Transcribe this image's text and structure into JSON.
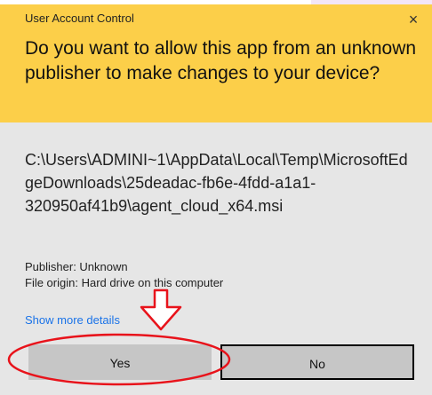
{
  "dialog": {
    "window_title": "User Account Control",
    "close_glyph": "×",
    "question": "Do you want to allow this app from an unknown publisher to make changes to your device?",
    "file_path": "C:\\Users\\ADMINI~1\\AppData\\Local\\Temp\\MicrosoftEdgeDownloads\\25deadac-fb6e-4fdd-a1a1-320950af41b9\\agent_cloud_x64.msi",
    "publisher": "Publisher: Unknown",
    "file_origin": "File origin: Hard drive on this computer",
    "show_more": "Show more details",
    "yes_label": "Yes",
    "no_label": "No"
  },
  "colors": {
    "header_bg": "#fccf49",
    "body_bg": "#e6e6e6",
    "link": "#1a73e8",
    "annotation": "#e8131b"
  },
  "annotation": {
    "arrow_icon": "arrow-down-icon",
    "highlight_shape": "ellipse-around-yes"
  }
}
